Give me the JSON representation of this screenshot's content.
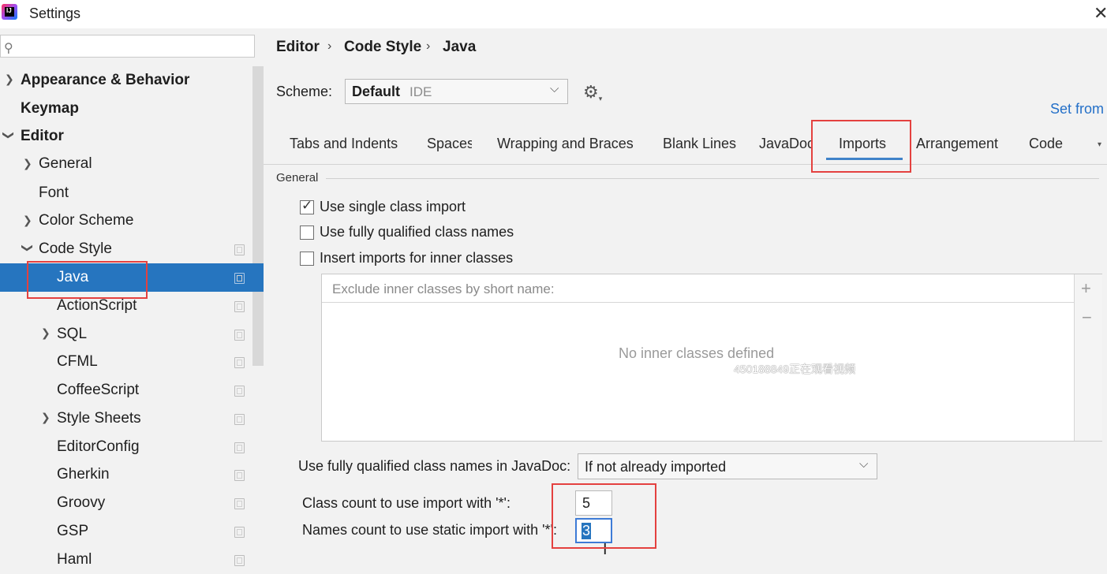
{
  "window": {
    "title": "Settings",
    "logo_text": "IJ",
    "close_icon": "close-icon"
  },
  "sidebar": {
    "search": {
      "icon": "search-icon",
      "value": ""
    },
    "items": [
      {
        "label": "Appearance & Behavior",
        "bold": true,
        "arrow": "right"
      },
      {
        "label": "Keymap",
        "bold": true
      },
      {
        "label": "Editor",
        "bold": true,
        "arrow": "down"
      },
      {
        "label": "General",
        "arrow": "right"
      },
      {
        "label": "Font"
      },
      {
        "label": "Color Scheme",
        "arrow": "right"
      },
      {
        "label": "Code Style",
        "arrow": "down"
      },
      {
        "label": "Java",
        "selected": true
      },
      {
        "label": "ActionScript"
      },
      {
        "label": "SQL",
        "arrow": "right"
      },
      {
        "label": "CFML"
      },
      {
        "label": "CoffeeScript"
      },
      {
        "label": "Style Sheets",
        "arrow": "right"
      },
      {
        "label": "EditorConfig"
      },
      {
        "label": "Gherkin"
      },
      {
        "label": "Groovy"
      },
      {
        "label": "GSP"
      },
      {
        "label": "Haml"
      }
    ]
  },
  "breadcrumb": {
    "items": [
      "Editor",
      "Code Style",
      "Java"
    ],
    "separator": "›"
  },
  "scheme": {
    "label": "Scheme:",
    "value": "Default",
    "tag": "IDE",
    "gear_icon": "gear-icon"
  },
  "set_from_link": "Set from",
  "tabs": [
    {
      "label": "Tabs and Indents"
    },
    {
      "label": "Spaces"
    },
    {
      "label": "Wrapping and Braces"
    },
    {
      "label": "Blank Lines"
    },
    {
      "label": "JavaDoc"
    },
    {
      "label": "Imports",
      "active": true
    },
    {
      "label": "Arrangement"
    },
    {
      "label": "Code"
    }
  ],
  "general": {
    "section_title": "General",
    "options": [
      {
        "label": "Use single class import",
        "checked": true
      },
      {
        "label": "Use fully qualified class names",
        "checked": false
      },
      {
        "label": "Insert imports for inner classes",
        "checked": false
      }
    ],
    "exclude_panel": {
      "header": "Exclude inner classes by short name:",
      "empty_text": "No inner classes defined",
      "add_icon": "+",
      "remove_icon": "−"
    },
    "watermark": "450188849正在观看视频",
    "javadoc": {
      "label": "Use fully qualified class names in JavaDoc:",
      "value": "If not already imported"
    },
    "class_count": {
      "label": "Class count to use import with '*':",
      "value": "5"
    },
    "names_count": {
      "label": "Names count to use static import with '*':",
      "value": "3"
    }
  },
  "colors": {
    "accent": "#2675bf",
    "highlight_box": "#e4413f",
    "tab_underline": "#4083c9",
    "link": "#2470c8"
  }
}
